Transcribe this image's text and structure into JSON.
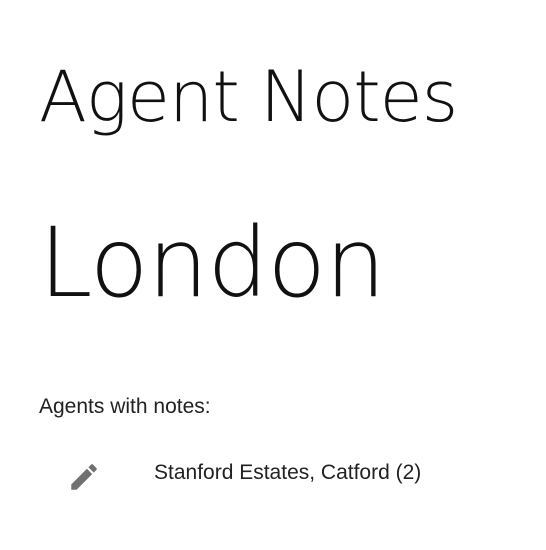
{
  "header": {
    "title": "Agent Notes"
  },
  "location": {
    "name": "London"
  },
  "agents_section": {
    "label": "Agents with notes:",
    "items": [
      {
        "name": "Stanford Estates, Catford (2)",
        "icon": "pencil-edit-icon"
      }
    ]
  },
  "colors": {
    "text": "#111111",
    "icon": "#707070",
    "background": "#ffffff"
  }
}
